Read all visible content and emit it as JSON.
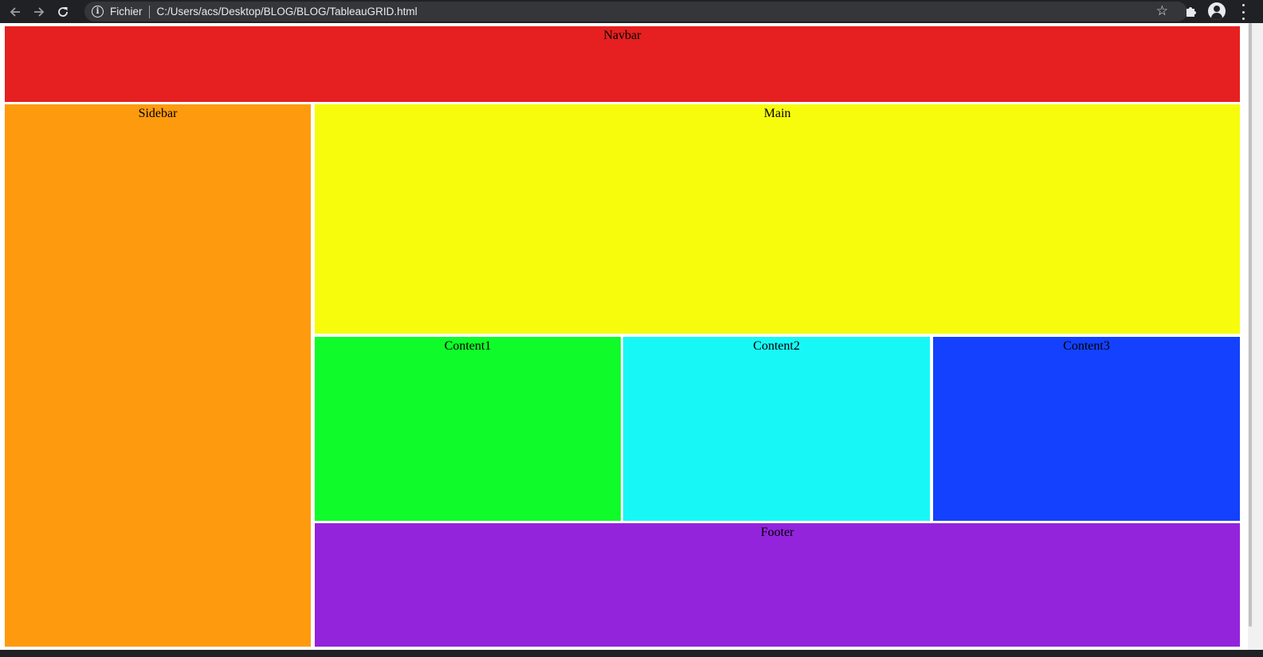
{
  "browser": {
    "scheme_label": "Fichier",
    "url": "C:/Users/acs/Desktop/BLOG/BLOG/TableauGRID.html",
    "icons": {
      "back": "arrow-left-icon",
      "forward": "arrow-right-icon",
      "reload": "reload-icon",
      "info": "info-icon",
      "star": "star-icon",
      "extensions": "puzzle-icon",
      "profile": "profile-icon",
      "menu": "menu-dots-icon"
    }
  },
  "grid": {
    "navbar": {
      "label": "Navbar",
      "color": "#e62020"
    },
    "sidebar": {
      "label": "Sidebar",
      "color": "#fe9a0e"
    },
    "main": {
      "label": "Main",
      "color": "#f7fc0d"
    },
    "content1": {
      "label": "Content1",
      "color": "#0ffc2a"
    },
    "content2": {
      "label": "Content2",
      "color": "#17f8f6"
    },
    "content3": {
      "label": "Content3",
      "color": "#1341fe"
    },
    "footer": {
      "label": "Footer",
      "color": "#9324dc"
    }
  }
}
